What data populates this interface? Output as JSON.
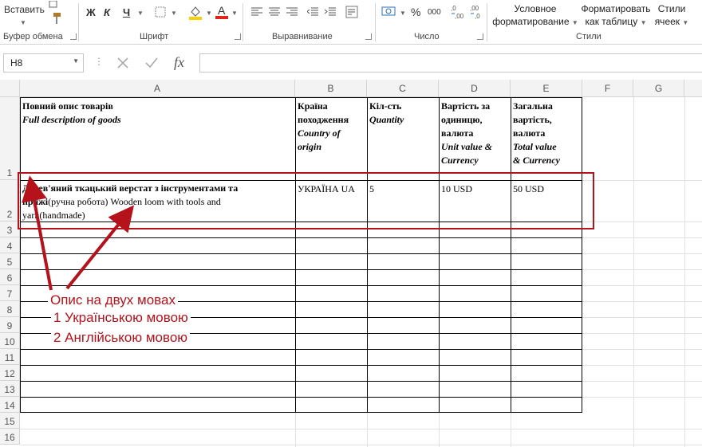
{
  "ribbon": {
    "paste_label": "Вставить",
    "groups": {
      "clipboard": "Буфер обмена",
      "font": "Шрифт",
      "alignment": "Выравнивание",
      "number": "Число",
      "styles": "Стили"
    },
    "font_buttons": {
      "bold": "Ж",
      "italic": "К",
      "underline": "Ч"
    },
    "percent": "%",
    "thousands": "000",
    "cond_format_line1": "Условное",
    "cond_format_line2": "форматирование",
    "format_table_line1": "Форматировать",
    "format_table_line2": "как таблицу",
    "cell_styles_line1": "Стили",
    "cell_styles_line2": "ячеек",
    "fill_color": "#f6d200",
    "font_color": "#e0231b"
  },
  "formula_bar": {
    "name_box": "H8",
    "fx": "fx",
    "formula": ""
  },
  "columns": [
    "A",
    "B",
    "C",
    "D",
    "E",
    "F",
    "G"
  ],
  "rows": [
    "1",
    "2",
    "3",
    "4",
    "5",
    "6",
    "7",
    "8",
    "9",
    "10",
    "11",
    "12",
    "13",
    "14",
    "15",
    "16"
  ],
  "header": {
    "a_ua": "Повний опис товарів",
    "a_en": "Full description of goods",
    "b_ua1": "Країна",
    "b_ua2": "походження",
    "b_en1": "Country of",
    "b_en2": "origin",
    "c_ua": "Кіл-сть",
    "c_en": "Quantity",
    "d_ua1": "Вартість за",
    "d_ua2": "одиницю,",
    "d_ua3": "валюта",
    "d_en1": "Unit value &",
    "d_en2": "Currency",
    "e_ua1": "Загальна",
    "e_ua2": "вартість,",
    "e_ua3": "валюта",
    "e_en1": "Total value",
    "e_en2": "& Currency"
  },
  "item": {
    "desc_bold": "Дерев'яний ткацький верстат з інструментами та пряжі",
    "desc_rest": "(ручна робота) Wooden loom with tools and yarn(handmade)",
    "country": "УКРАЇНА UA",
    "qty": "5",
    "unit_value": "10 USD",
    "total_value": "50 USD"
  },
  "annotation": {
    "line1": "Опис на двух мовах",
    "line2": "1 Українською мовою",
    "line3": "2 Англійською мовою",
    "color": "#b5121b"
  }
}
